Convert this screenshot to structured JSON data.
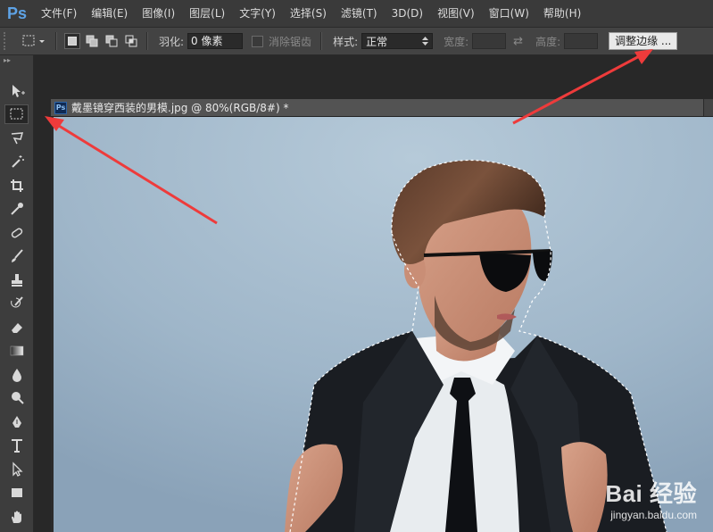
{
  "app": {
    "logo": "Ps",
    "menu": [
      "文件(F)",
      "编辑(E)",
      "图像(I)",
      "图层(L)",
      "文字(Y)",
      "选择(S)",
      "滤镜(T)",
      "3D(D)",
      "视图(V)",
      "窗口(W)",
      "帮助(H)"
    ]
  },
  "options": {
    "feather_label": "羽化:",
    "feather_value": "0 像素",
    "antialias_label": "消除锯齿",
    "style_label": "样式:",
    "style_value": "正常",
    "width_label": "宽度:",
    "height_label": "高度:",
    "swap_glyph": "⇄",
    "refine_edge_label": "调整边缘 ..."
  },
  "document": {
    "tab_icon": "Ps",
    "title": "戴墨镜穿西装的男模.jpg @ 80%(RGB/8#) *"
  },
  "watermark": {
    "brand": "Bai 经验",
    "url": "jingyan.baidu.com"
  },
  "colors": {
    "accent_blue": "#5ea3e6",
    "arrow_red": "#ee3b3b",
    "backdrop": "#a6bccd"
  },
  "tools": [
    "move-tool-icon",
    "marquee-tool-icon",
    "lasso-tool-icon",
    "magic-wand-icon",
    "crop-tool-icon",
    "eyedropper-icon",
    "healing-brush-icon",
    "brush-tool-icon",
    "clone-stamp-icon",
    "history-brush-icon",
    "eraser-icon",
    "gradient-icon",
    "blur-icon",
    "dodge-icon",
    "pen-tool-icon",
    "type-tool-icon",
    "path-select-icon",
    "rectangle-tool-icon",
    "hand-tool-icon"
  ]
}
